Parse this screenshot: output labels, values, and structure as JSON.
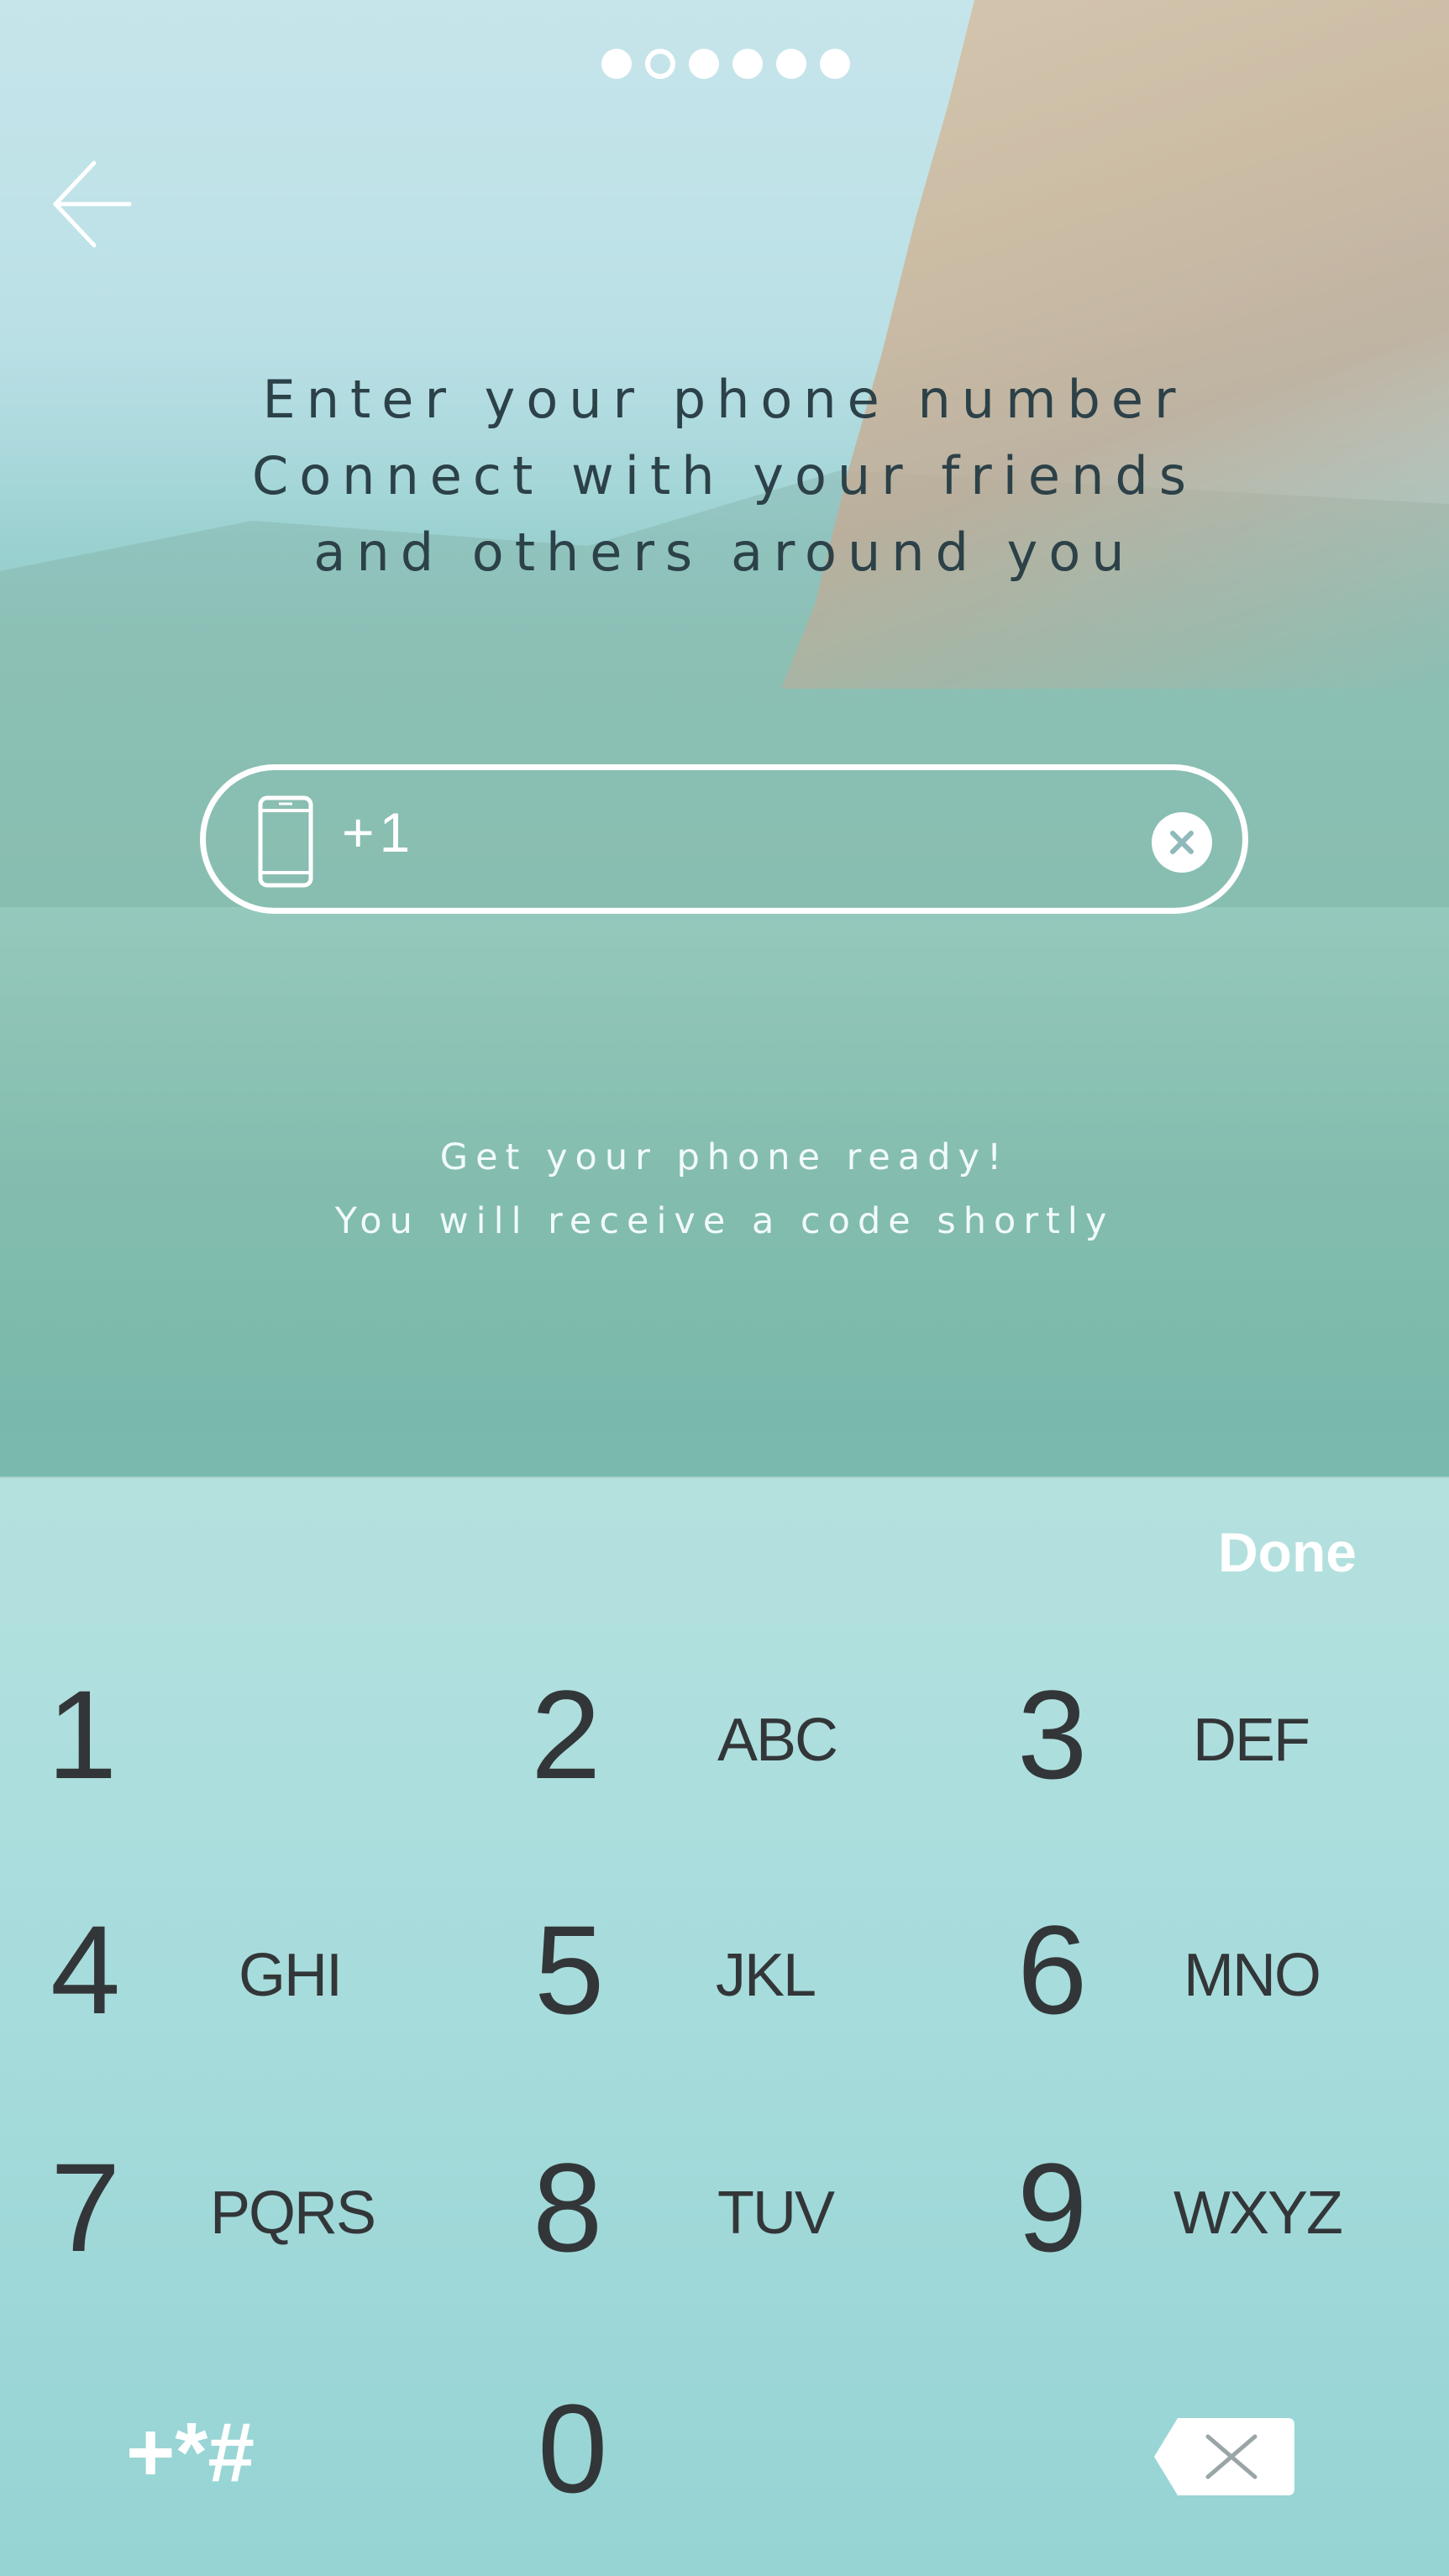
{
  "pager": {
    "count": 6,
    "active_index": 1
  },
  "header": {
    "back_icon": "arrow-left-icon",
    "headline": [
      "Enter your phone number",
      "Connect with your friends",
      "and others around you"
    ]
  },
  "phone_field": {
    "icon": "smartphone-icon",
    "prefix": "+1",
    "clear_icon": "clear-icon"
  },
  "hint": [
    "Get your phone ready!",
    "You will receive a code shortly"
  ],
  "keyboard": {
    "done_label": "Done",
    "keys": [
      {
        "digit": "1",
        "letters": ""
      },
      {
        "digit": "2",
        "letters": "ABC"
      },
      {
        "digit": "3",
        "letters": "DEF"
      },
      {
        "digit": "4",
        "letters": "GHI"
      },
      {
        "digit": "5",
        "letters": "JKL"
      },
      {
        "digit": "6",
        "letters": "MNO"
      },
      {
        "digit": "7",
        "letters": "PQRS"
      },
      {
        "digit": "8",
        "letters": "TUV"
      },
      {
        "digit": "9",
        "letters": "WXYZ"
      },
      {
        "digit": "0",
        "letters": ""
      }
    ],
    "symbols_label": "+*#",
    "delete_icon": "backspace-icon"
  },
  "colors": {
    "text_dark": "#333638",
    "headline": "#2c4148",
    "white": "#ffffff"
  }
}
